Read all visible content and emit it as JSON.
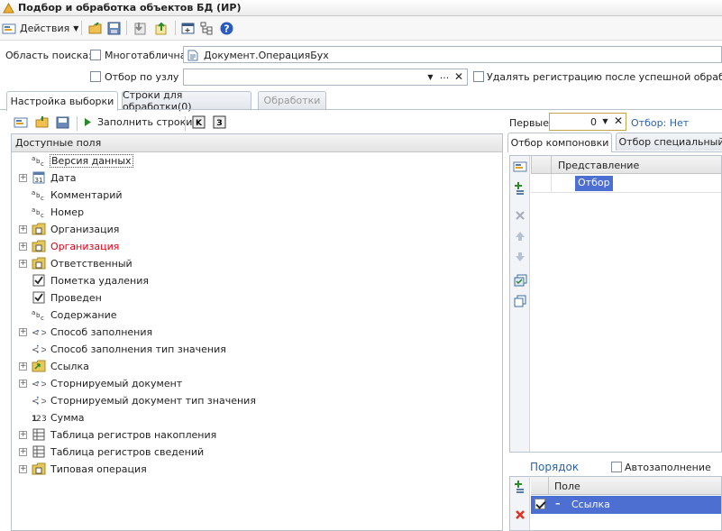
{
  "window": {
    "title": "Подбор и обработка объектов БД (ИР)"
  },
  "toolbar": {
    "actions_label": "Действия"
  },
  "search": {
    "area_label": "Область поиска:",
    "multi_table_label": "Многотабличная",
    "object_value": "Документ.ОперацияБух",
    "node_filter_label": "Отбор по узлу",
    "delete_registration_label": "Удалять регистрацию после успешной обработки"
  },
  "tabs": [
    {
      "label": "Настройка выборки"
    },
    {
      "label": "Строки для обработки(0)"
    },
    {
      "label": "Обработки"
    }
  ],
  "fill": {
    "fill_rows_label": "Заполнить строки"
  },
  "available_fields": {
    "header": "Доступные поля",
    "items": [
      {
        "label": "Версия данных",
        "icon": "abc-icon"
      },
      {
        "label": "Дата",
        "icon": "calendar-icon"
      },
      {
        "label": "Комментарий",
        "icon": "abc-icon"
      },
      {
        "label": "Номер",
        "icon": "abc-icon"
      },
      {
        "label": "Организация",
        "icon": "reference-icon"
      },
      {
        "label": "Организация",
        "icon": "reference-icon"
      },
      {
        "label": "Ответственный",
        "icon": "reference-icon"
      },
      {
        "label": "Пометка удаления",
        "icon": "checkbox-icon"
      },
      {
        "label": "Проведен",
        "icon": "checkbox-icon"
      },
      {
        "label": "Содержание",
        "icon": "abc-icon"
      },
      {
        "label": "Способ заполнения",
        "icon": "enum-icon"
      },
      {
        "label": "Способ заполнения тип значения",
        "icon": "type-icon"
      },
      {
        "label": "Ссылка",
        "icon": "link-icon"
      },
      {
        "label": "Сторнируемый документ",
        "icon": "enum-icon"
      },
      {
        "label": "Сторнируемый документ тип значения",
        "icon": "type-icon"
      },
      {
        "label": "Сумма",
        "icon": "number-icon"
      },
      {
        "label": "Таблица регистров накопления",
        "icon": "table-icon"
      },
      {
        "label": "Таблица регистров сведений",
        "icon": "table-icon"
      },
      {
        "label": "Типовая операция",
        "icon": "reference-icon"
      }
    ],
    "highlight_color": "#e0001a"
  },
  "right": {
    "first_label": "Первые:",
    "first_value": "0",
    "filter_status": "Отбор: Нет",
    "tabs": [
      {
        "label": "Отбор компоновки"
      },
      {
        "label": "Отбор специальный"
      }
    ],
    "grid_header": "Представление",
    "grid_row": "Отбор",
    "order_label": "Порядок",
    "auto_fill_label": "Автозаполнение",
    "order_header": "Поле",
    "order_row": "Ссылка"
  },
  "colors": {
    "accent": "#4a6bc7",
    "selection": "#4d6fd1",
    "link": "#2c63a8"
  }
}
